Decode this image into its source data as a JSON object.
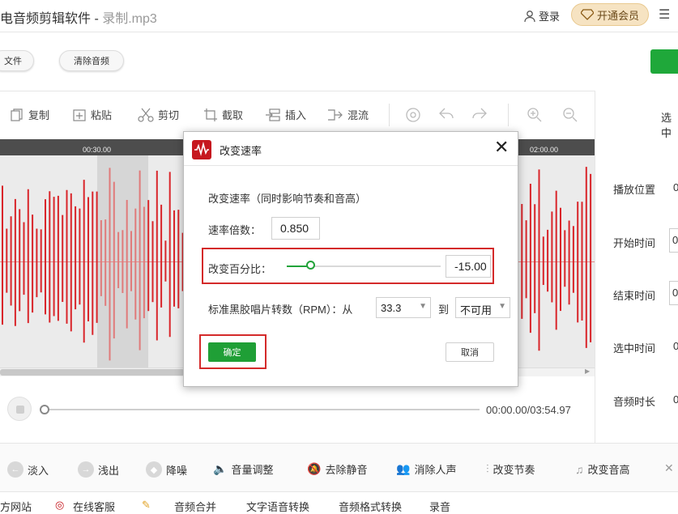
{
  "window": {
    "app_name": "电音频剪辑软件 - ",
    "file_name": "录制.mp3",
    "login_label": "登录",
    "vip_label": "开通会员",
    "menu_icon": "menu-icon"
  },
  "actions": {
    "open_file_label": "文件",
    "clear_audio_label": "清除音频"
  },
  "toolbar": {
    "items": [
      {
        "label": "复制",
        "icon": "copy-icon"
      },
      {
        "label": "粘贴",
        "icon": "paste-icon"
      },
      {
        "label": "剪切",
        "icon": "scissors-icon"
      },
      {
        "label": "截取",
        "icon": "crop-icon"
      },
      {
        "label": "插入",
        "icon": "insert-icon"
      },
      {
        "label": "混流",
        "icon": "mix-icon"
      }
    ],
    "right_partial": "选中"
  },
  "timeline": {
    "ticks": [
      "00:30.00",
      "02:00.00"
    ]
  },
  "info_panel": {
    "labels": [
      "播放位置",
      "开始时间",
      "结束时间",
      "选中时间",
      "音频时长"
    ],
    "first_char": "0"
  },
  "transport": {
    "timecode": "00:00.00/03:54.97"
  },
  "effects": [
    {
      "label": "淡入",
      "icon": "fade-in-icon"
    },
    {
      "label": "浅出",
      "icon": "fade-out-icon"
    },
    {
      "label": "降噪",
      "icon": "denoise-icon"
    },
    {
      "label": "音量调整",
      "icon": "volume-icon"
    },
    {
      "label": "去除静音",
      "icon": "mute-remove-icon"
    },
    {
      "label": "消除人声",
      "icon": "vocal-remove-icon"
    },
    {
      "label": "改变节奏",
      "icon": "tempo-icon"
    },
    {
      "label": "改变音高",
      "icon": "pitch-icon"
    }
  ],
  "bottom_links": [
    "方网站",
    "在线客服",
    "音频合并",
    "文字语音转换",
    "音频格式转换",
    "录音"
  ],
  "dialog": {
    "title": "改变速率",
    "description": "改变速率（同时影响节奏和音高）",
    "rate_label": "速率倍数：",
    "rate_value": "0.850",
    "percent_label": "改变百分比：",
    "percent_value": "-15.00",
    "slider_fraction": 0.15,
    "rpm_label": "标准黑胶唱片转数（RPM）：从",
    "rpm_from": "33.3",
    "rpm_to_label": "到",
    "rpm_to": "不可用",
    "ok_label": "确定",
    "cancel_label": "取消"
  },
  "colors": {
    "accent_green": "#1f9f36",
    "highlight_red": "#d42a2a",
    "wave_red": "#d9252a"
  }
}
